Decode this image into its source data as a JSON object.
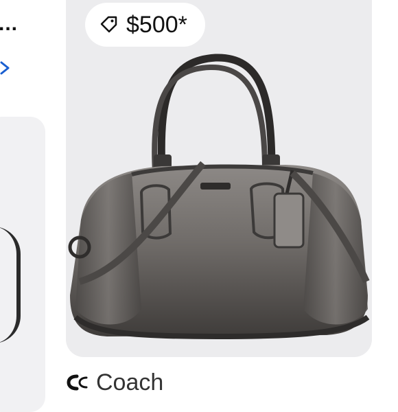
{
  "left_card": {
    "overflow_text": "..."
  },
  "product": {
    "price": "$500*",
    "brand": "Coach"
  },
  "icons": {
    "price_tag": "tag-icon",
    "chevron": "chevron-right-icon",
    "brand_logo": "coach-logo-icon"
  },
  "colors": {
    "card_bg": "#ececee",
    "pill_bg": "#ffffff",
    "link_blue": "#1a5fd0",
    "text_dark": "#111111"
  }
}
